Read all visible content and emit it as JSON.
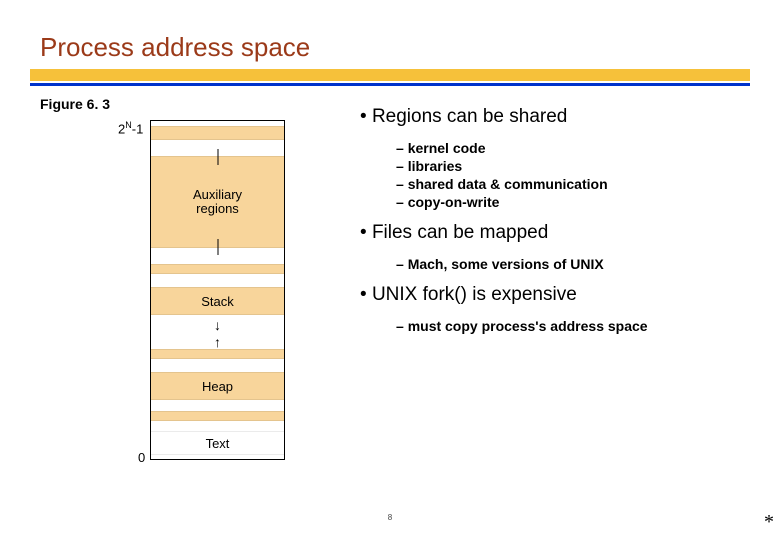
{
  "title": "Process address space",
  "figure": {
    "label": "Figure 6. 3",
    "axis_top": {
      "base": "2",
      "exp": "N",
      "suffix": "-1"
    },
    "axis_bottom": "0",
    "regions": {
      "auxiliary": "Auxiliary\nregions",
      "stack": "Stack",
      "heap": "Heap",
      "text": "Text"
    }
  },
  "bullets": {
    "b1": {
      "text": "Regions can be shared",
      "sub": [
        "kernel code",
        "libraries",
        "shared data & communication",
        "copy-on-write"
      ]
    },
    "b2": {
      "text": "Files can be mapped",
      "sub": [
        "Mach, some versions of UNIX"
      ]
    },
    "b3": {
      "text": "UNIX fork() is expensive",
      "sub": [
        "must copy process's address space"
      ]
    }
  },
  "pagenum": "8",
  "star": "*"
}
